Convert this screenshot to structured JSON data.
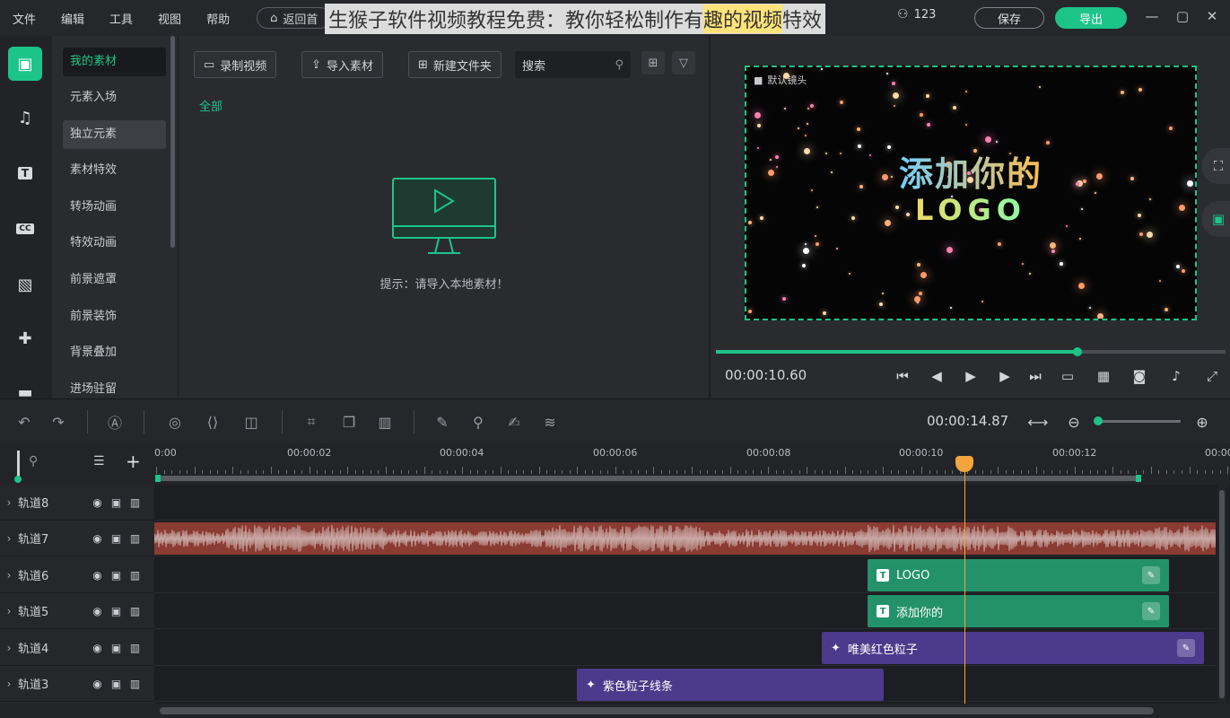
{
  "menu": [
    "文件",
    "编辑",
    "工具",
    "视图",
    "帮助"
  ],
  "back_label": "返回首",
  "overlay_title": {
    "before": "生猴子软件视频教程免费：教你轻松制作有",
    "highlight": "趣的视频",
    "after": "特效"
  },
  "user": {
    "name": "123"
  },
  "save_label": "保存",
  "export_label": "导出",
  "rail_icons": [
    "media-icon",
    "music-icon",
    "text-icon",
    "caption-icon",
    "filter-icon",
    "plugin-icon",
    "folder-icon"
  ],
  "categories": [
    "我的素材",
    "元素入场",
    "独立元素",
    "素材特效",
    "转场动画",
    "特效动画",
    "前景遮罩",
    "前景装饰",
    "背景叠加",
    "进场驻留"
  ],
  "media": {
    "record_label": "录制视频",
    "import_label": "导入素材",
    "new_folder_label": "新建文件夹",
    "search_placeholder": "搜索",
    "all_tab": "全部",
    "hint": "提示：请导入本地素材！"
  },
  "preview": {
    "camera_label": "默认镜头",
    "title_line1": "添加你的",
    "title_line2": "LOGO",
    "current_time": "00:00:10.60",
    "progress": 0.71
  },
  "timeline": {
    "total_time": "00:00:14.87",
    "ruler_labels": [
      "0:00",
      "00:00:02",
      "00:00:04",
      "00:00:06",
      "00:00:08",
      "00:00:10",
      "00:00:12",
      "00:00"
    ],
    "zoom": 0.0,
    "tracks": [
      {
        "name": "轨道8"
      },
      {
        "name": "轨道7"
      },
      {
        "name": "轨道6"
      },
      {
        "name": "轨道5"
      },
      {
        "name": "轨道4"
      },
      {
        "name": "轨道3"
      }
    ],
    "clips": {
      "logo": "LOGO",
      "add_your": "添加你的",
      "red_particles": "唯美红色粒子",
      "purple_lines": "紫色粒子线条"
    }
  },
  "colors": {
    "accent": "#1dc48a",
    "playhead": "#f2a53a",
    "audio": "#8a3b32",
    "fx_clip": "#4c3a8c",
    "text_clip": "#23926a"
  }
}
